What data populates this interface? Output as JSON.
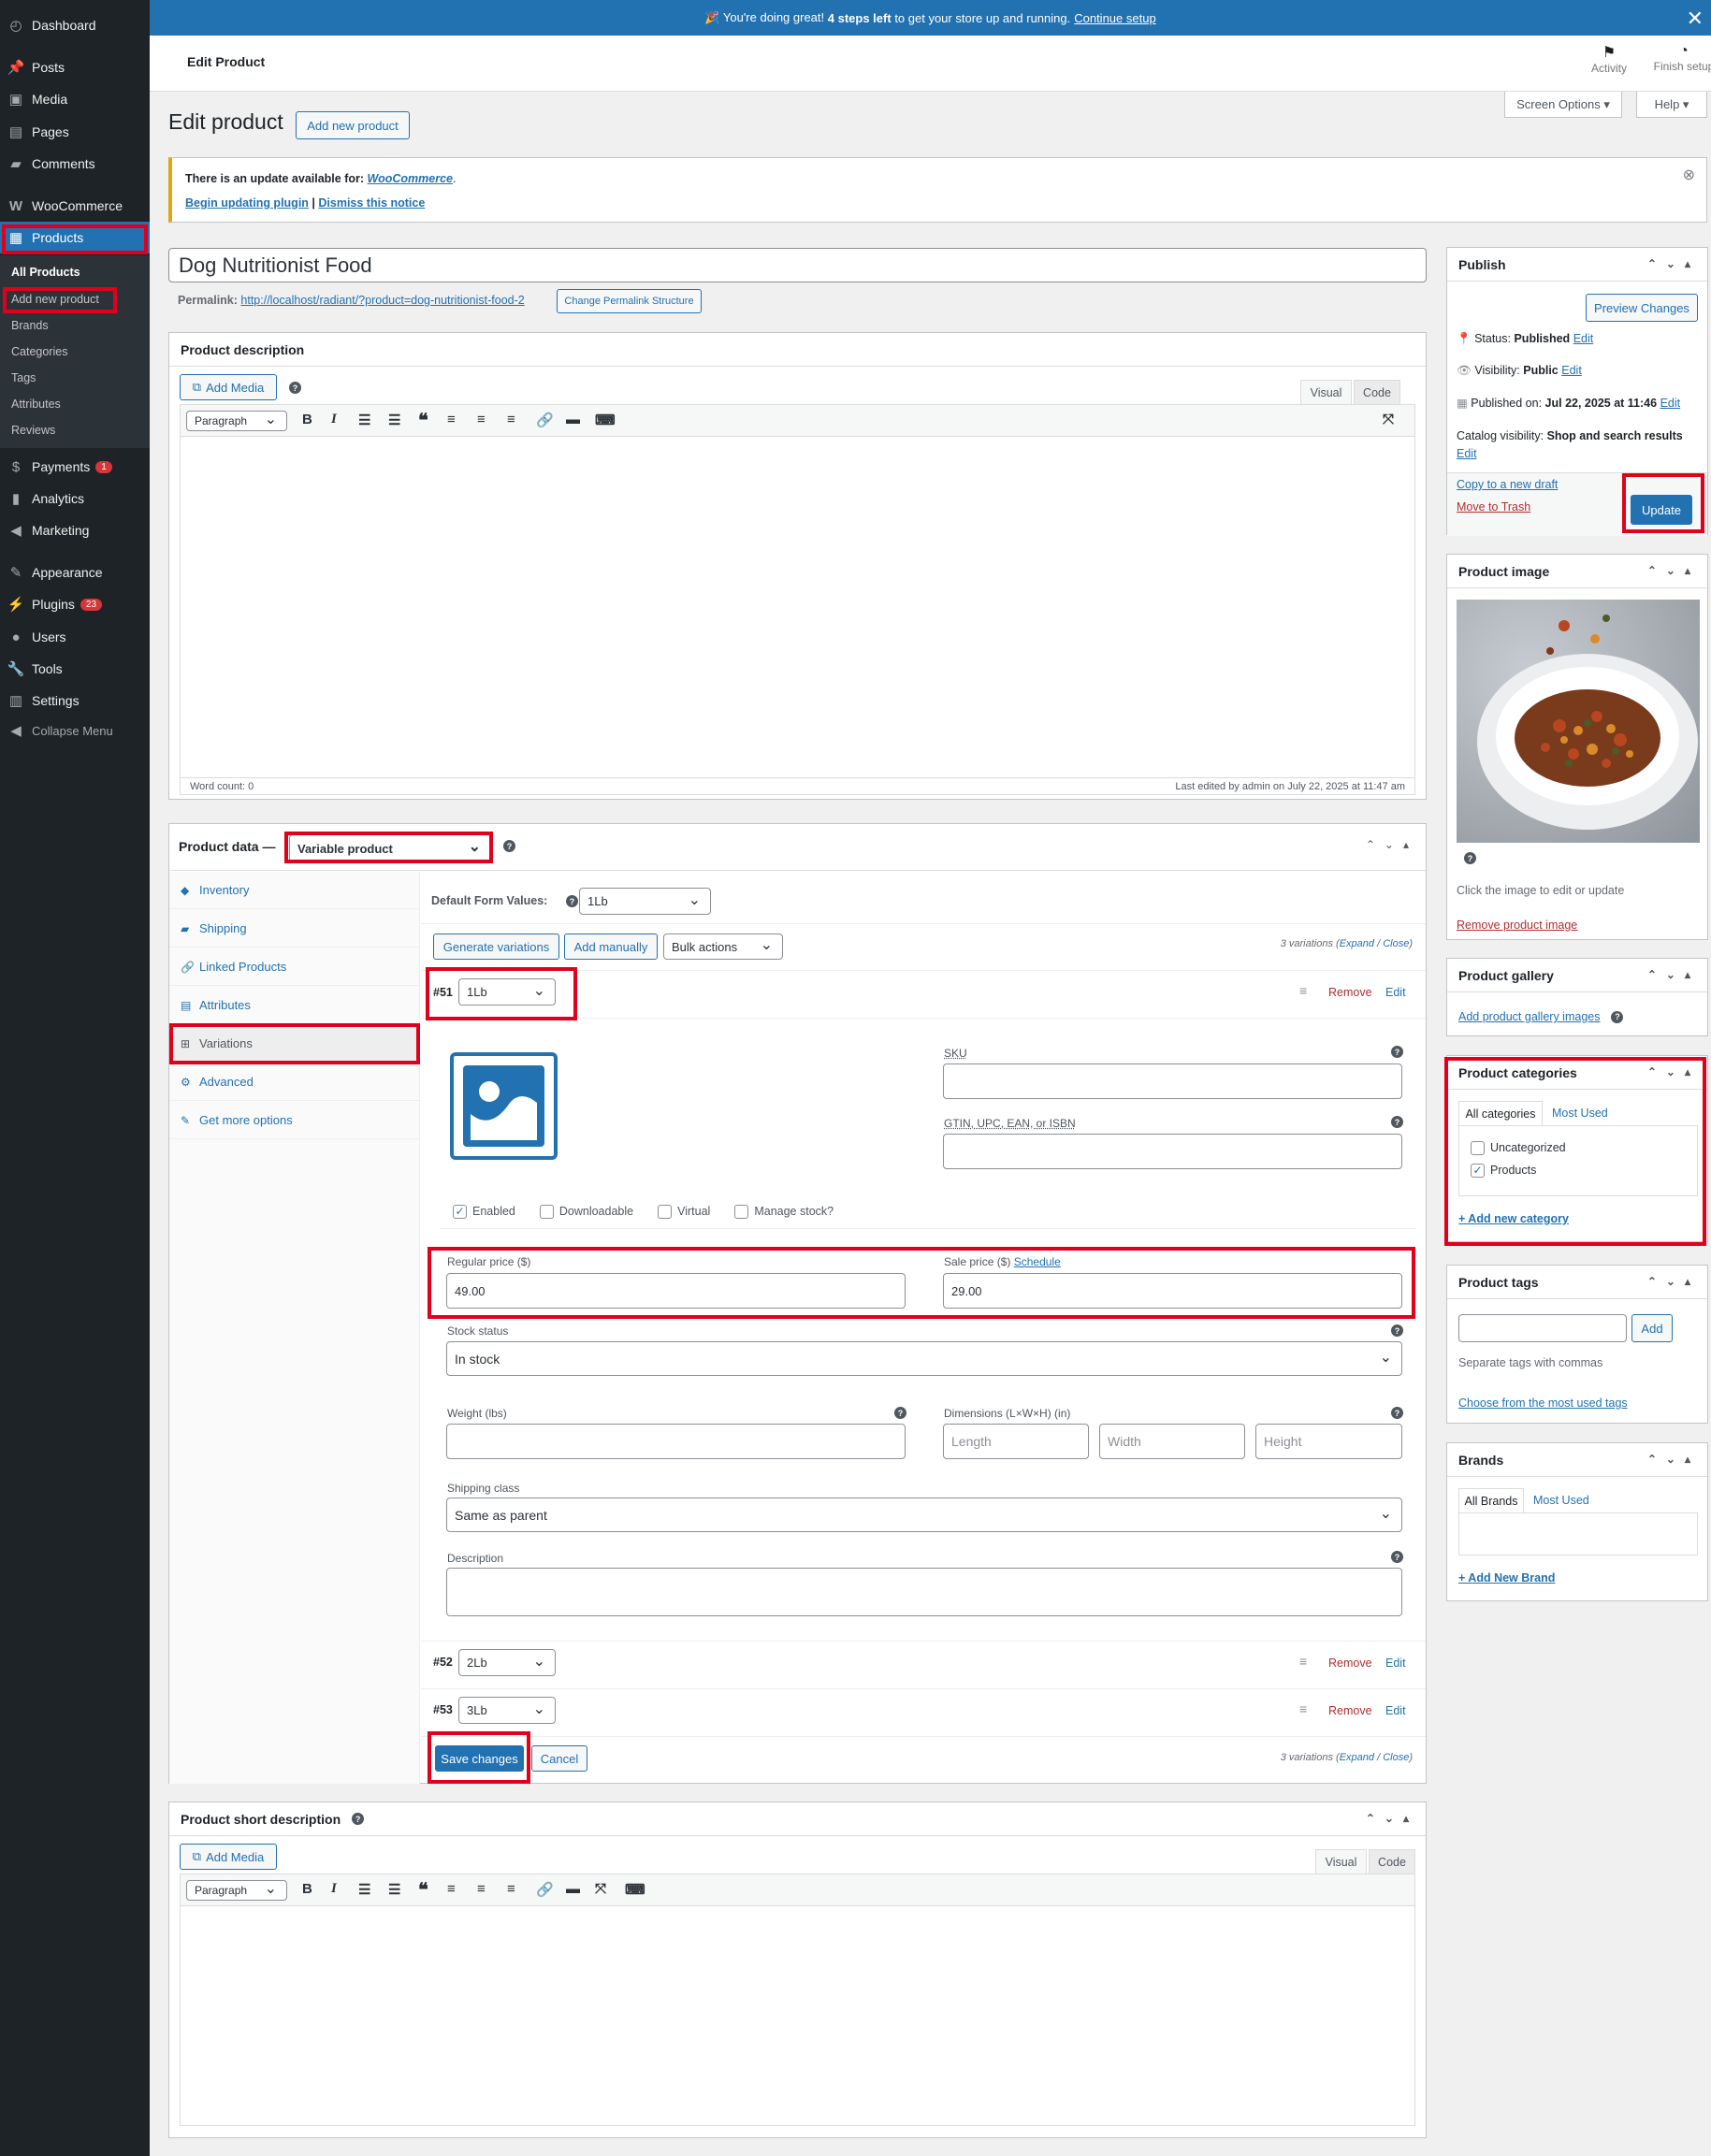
{
  "sidebar": {
    "items": [
      {
        "label": "Dashboard",
        "icon": "dashboard-icon"
      },
      {
        "label": "Posts",
        "icon": "pin-icon"
      },
      {
        "label": "Media",
        "icon": "media-icon"
      },
      {
        "label": "Pages",
        "icon": "page-icon"
      },
      {
        "label": "Comments",
        "icon": "comment-icon"
      },
      {
        "label": "WooCommerce",
        "icon": "woo-icon"
      },
      {
        "label": "Products",
        "icon": "archive-icon"
      },
      {
        "label": "Payments",
        "icon": "payments-icon",
        "badge": "1"
      },
      {
        "label": "Analytics",
        "icon": "chart-icon"
      },
      {
        "label": "Marketing",
        "icon": "megaphone-icon"
      },
      {
        "label": "Appearance",
        "icon": "brush-icon"
      },
      {
        "label": "Plugins",
        "icon": "plugin-icon",
        "badge": "23"
      },
      {
        "label": "Users",
        "icon": "user-icon"
      },
      {
        "label": "Tools",
        "icon": "wrench-icon"
      },
      {
        "label": "Settings",
        "icon": "settings-icon"
      },
      {
        "label": "Collapse Menu",
        "icon": "collapse-icon"
      }
    ],
    "submenu": [
      "All Products",
      "Add new product",
      "Brands",
      "Categories",
      "Tags",
      "Attributes",
      "Reviews"
    ]
  },
  "topbar": {
    "pre": "🎉 You're doing great!",
    "bold": "4 steps left",
    "post": "to get your store up and running.",
    "link": "Continue setup"
  },
  "header": {
    "title": "Edit Product",
    "activity": "Activity",
    "finish": "Finish setup"
  },
  "screen_options": "Screen Options ▾",
  "help": "Help ▾",
  "page_title": "Edit product",
  "add_new": "Add new product",
  "notice": {
    "text": "There is an update available for:",
    "plugin": "WooCommerce",
    "after": ".",
    "begin": "Begin updating plugin",
    "sep": "|",
    "dismiss": "Dismiss this notice"
  },
  "product": {
    "title": "Dog Nutritionist Food",
    "permalink_label": "Permalink:",
    "permalink": "http://localhost/radiant/?product=dog-nutritionist-food-2",
    "permalink_btn": "Change Permalink Structure"
  },
  "desc": {
    "heading": "Product description",
    "add_media": "Add Media",
    "visual": "Visual",
    "code": "Code",
    "format": "Paragraph",
    "word_count": "Word count: 0",
    "last_edited": "Last edited by admin on July 22, 2025 at 11:47 am"
  },
  "pdata": {
    "heading": "Product data —",
    "type": "Variable product",
    "tabs": [
      "Inventory",
      "Shipping",
      "Linked Products",
      "Attributes",
      "Variations",
      "Advanced",
      "Get more options"
    ],
    "default_label": "Default Form Values:",
    "default_val": "1Lb",
    "gen": "Generate variations",
    "add_manually": "Add manually",
    "bulk": "Bulk actions",
    "count": "3 variations",
    "expand": "Expand",
    "slash": "/",
    "close": "Close",
    "v51": {
      "id": "#51",
      "val": "1Lb"
    },
    "v52": {
      "id": "#52",
      "val": "2Lb"
    },
    "v53": {
      "id": "#53",
      "val": "3Lb"
    },
    "remove": "Remove",
    "edit": "Edit",
    "sku": "SKU",
    "gtin": "GTIN, UPC, EAN, or ISBN",
    "enabled": "Enabled",
    "downloadable": "Downloadable",
    "virtual": "Virtual",
    "manage": "Manage stock?",
    "regular_label": "Regular price ($)",
    "regular": "49.00",
    "sale_label": "Sale price ($)",
    "schedule": "Schedule",
    "sale": "29.00",
    "stock_label": "Stock status",
    "stock": "In stock",
    "weight": "Weight (lbs)",
    "dims": "Dimensions (L×W×H) (in)",
    "length": "Length",
    "width": "Width",
    "height": "Height",
    "ship_label": "Shipping class",
    "ship": "Same as parent",
    "description": "Description",
    "save": "Save changes",
    "cancel": "Cancel"
  },
  "short": {
    "heading": "Product short description"
  },
  "publish": {
    "heading": "Publish",
    "preview": "Preview Changes",
    "status_l": "Status:",
    "status": "Published",
    "vis_l": "Visibility:",
    "vis": "Public",
    "pub_l": "Published on:",
    "pub": "Jul 22, 2025 at 11:46",
    "cat_l": "Catalog visibility:",
    "cat": "Shop and search results",
    "edit": "Edit",
    "copy": "Copy to a new draft",
    "trash": "Move to Trash",
    "update": "Update"
  },
  "pimage": {
    "heading": "Product image",
    "hint": "Click the image to edit or update",
    "remove": "Remove product image"
  },
  "gallery": {
    "heading": "Product gallery",
    "add": "Add product gallery images"
  },
  "cats": {
    "heading": "Product categories",
    "all": "All categories",
    "most": "Most Used",
    "uncat": "Uncategorized",
    "products": "Products",
    "add": "+ Add new category"
  },
  "tags": {
    "heading": "Product tags",
    "add": "Add",
    "sep": "Separate tags with commas",
    "choose": "Choose from the most used tags"
  },
  "brands": {
    "heading": "Brands",
    "all": "All Brands",
    "most": "Most Used",
    "add": "+ Add New Brand"
  },
  "colors": {
    "accent": "#2271b1",
    "highlight": "#e0001b",
    "sidebar": "#1d2327"
  }
}
